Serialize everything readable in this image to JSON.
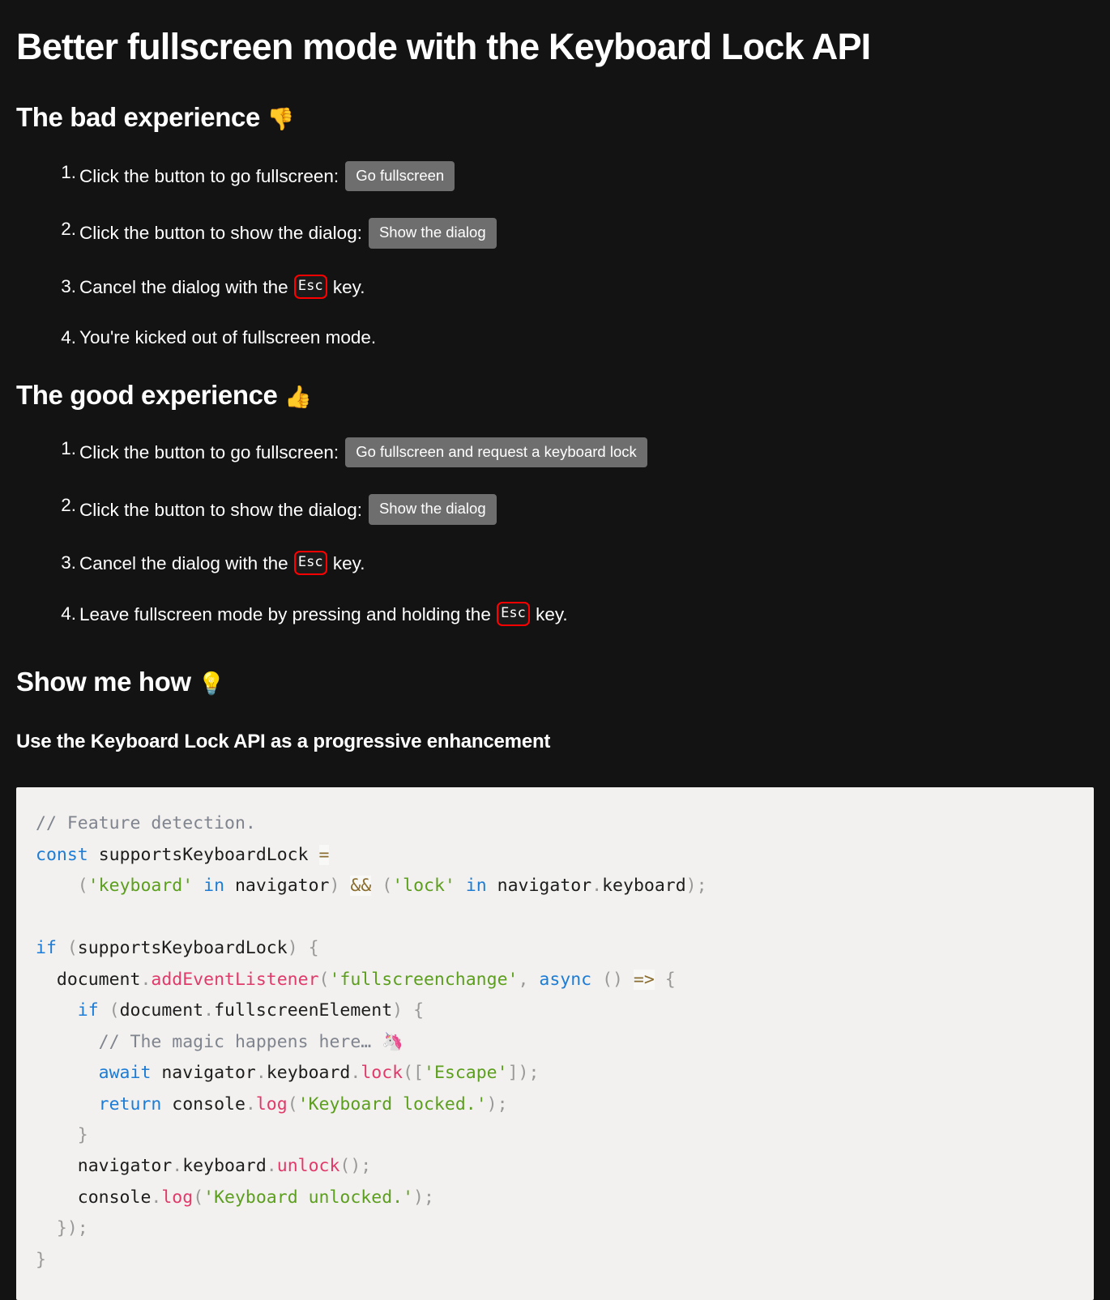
{
  "page": {
    "title": "Better fullscreen mode with the Keyboard Lock API",
    "background_color": "#131313",
    "text_color": "#ffffff"
  },
  "sections": {
    "bad": {
      "heading": "The bad experience ",
      "heading_emoji": "👎",
      "steps": [
        {
          "text_before": "Click the button to go fullscreen:",
          "button": "Go fullscreen"
        },
        {
          "text_before": "Click the button to show the dialog:",
          "button": "Show the dialog"
        },
        {
          "text_before": "Cancel the dialog with the ",
          "kbd": "Esc",
          "text_after": " key."
        },
        {
          "text_before": "You're kicked out of fullscreen mode."
        }
      ]
    },
    "good": {
      "heading": "The good experience ",
      "heading_emoji": "👍",
      "steps": [
        {
          "text_before": "Click the button to go fullscreen:",
          "button": "Go fullscreen and request a keyboard lock"
        },
        {
          "text_before": "Click the button to show the dialog:",
          "button": "Show the dialog"
        },
        {
          "text_before": "Cancel the dialog with the ",
          "kbd": "Esc",
          "text_after": " key."
        },
        {
          "text_before": "Leave fullscreen mode by pressing and holding the ",
          "kbd": "Esc",
          "text_after": " key."
        }
      ]
    },
    "howto": {
      "heading": "Show me how ",
      "heading_emoji": "💡",
      "subheading": "Use the Keyboard Lock API as a progressive enhancement"
    }
  },
  "code": {
    "language": "javascript",
    "background_color": "#f2f1ef",
    "colors": {
      "comment": "#7f848e",
      "keyword": "#1c7cd6",
      "string": "#5c9e1e",
      "function": "#e13a6a",
      "punctuation": "#999999",
      "operator": "#8a6d2f",
      "plain": "#1d1d1d"
    },
    "text": "// Feature detection.\nconst supportsKeyboardLock =\n    ('keyboard' in navigator) && ('lock' in navigator.keyboard);\n\nif (supportsKeyboardLock) {\n  document.addEventListener('fullscreenchange', async () => {\n    if (document.fullscreenElement) {\n      // The magic happens here… 🦄\n      await navigator.keyboard.lock(['Escape']);\n      return console.log('Keyboard locked.');\n    }\n    navigator.keyboard.unlock();\n    console.log('Keyboard unlocked.');\n  });\n}"
  }
}
